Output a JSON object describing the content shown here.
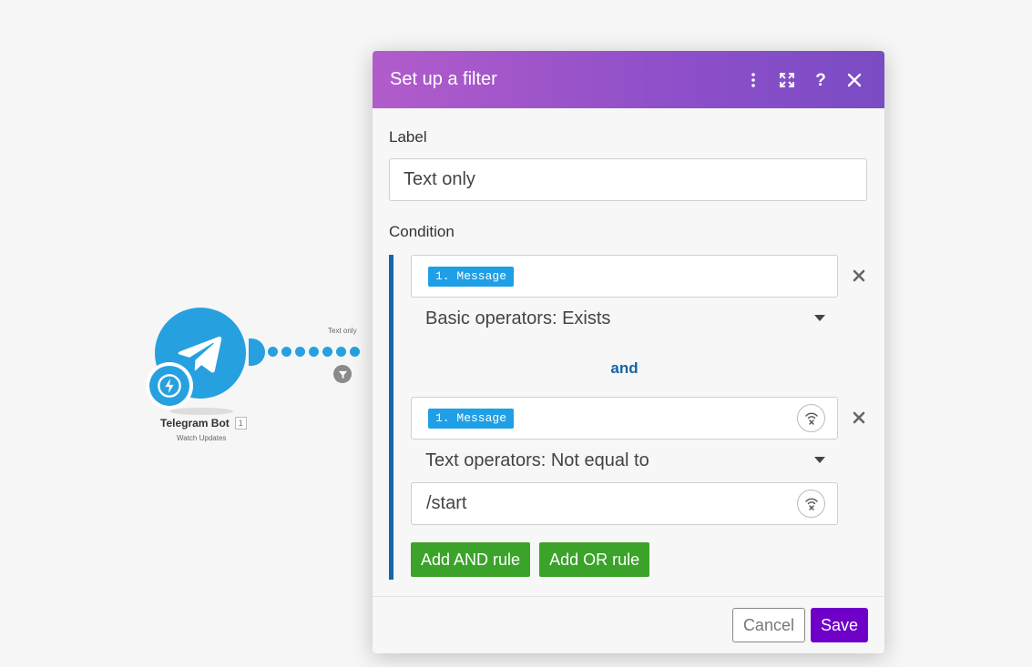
{
  "canvas": {
    "module": {
      "title": "Telegram Bot",
      "number": "1",
      "subtitle": "Watch Updates",
      "icon": "telegram-icon",
      "trigger_icon": "lightning-icon",
      "color": "#27a0df"
    },
    "connection": {
      "label": "Text only",
      "filter_icon": "filter-funnel-icon"
    }
  },
  "dialog": {
    "title": "Set up a filter",
    "header_buttons": [
      "more-vertical-icon",
      "expand-icon",
      "help-icon",
      "close-icon"
    ],
    "header_gradient": [
      "#b25ccb",
      "#7a4cc4"
    ],
    "label_field": {
      "label": "Label",
      "value": "Text only"
    },
    "condition": {
      "label": "Condition",
      "rules": [
        {
          "field_pill": "1. Message",
          "operator": "Basic operators: Exists"
        },
        {
          "field_pill": "1. Message",
          "operator": "Text operators: Not equal to",
          "value": "/start"
        }
      ],
      "joiner": "and",
      "add_and_label": "Add AND rule",
      "add_or_label": "Add OR rule"
    },
    "footer": {
      "cancel_label": "Cancel",
      "save_label": "Save"
    },
    "colors": {
      "accent_blue": "#1565a8",
      "pill_blue": "#1e9fe6",
      "green": "#3ba32a",
      "save_purple": "#6f00c8"
    }
  }
}
